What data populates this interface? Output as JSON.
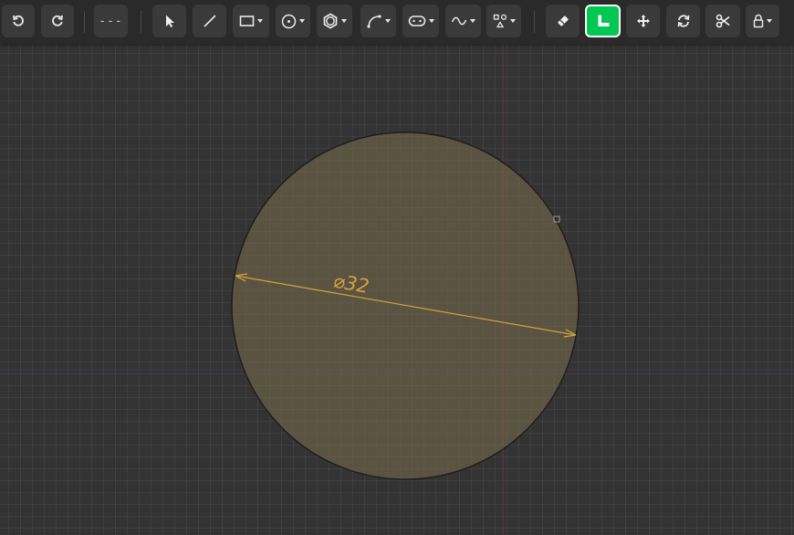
{
  "toolbar": {
    "line_style_label": "---",
    "groups": {
      "history": [
        "undo",
        "redo"
      ],
      "draw": [
        "select",
        "line",
        "rectangle",
        "circle",
        "polygon",
        "arc",
        "slot",
        "spline",
        "points"
      ],
      "modify": [
        "eraser",
        "dimension",
        "move",
        "rotate",
        "trim",
        "lock"
      ]
    },
    "active_tool": "dimension",
    "active_color": "#00c853"
  },
  "drawing": {
    "shape": "circle",
    "fill_color": "#5b5446",
    "stroke_color": "#1e1e1e",
    "dimension": {
      "label": "⌀32",
      "color": "#d4a23a"
    }
  }
}
